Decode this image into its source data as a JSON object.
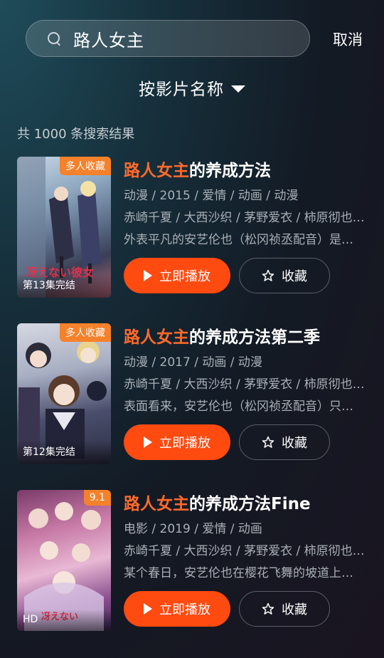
{
  "search": {
    "query": "路人女主",
    "cancel_label": "取消"
  },
  "sort": {
    "label": "按影片名称"
  },
  "result_count_text": "共 1000 条搜索结果",
  "results": [
    {
      "badge": "多人收藏",
      "episode_info": "第13集完结",
      "title_highlight": "路人女主",
      "title_rest": "的养成方法",
      "tags": "动漫 / 2015 / 爱情 / 动画 / 动漫",
      "cast": "赤崎千夏 / 大西沙织 / 茅野爱衣 / 柿原彻也…",
      "summary": "外表平凡的安艺伦也（松冈祯丞配音）是…",
      "play_label": "立即播放",
      "fav_label": "收藏"
    },
    {
      "badge": "多人收藏",
      "episode_info": "第12集完结",
      "title_highlight": "路人女主",
      "title_rest": "的养成方法第二季",
      "tags": "动漫 / 2017 / 动画 / 动漫",
      "cast": "赤崎千夏 / 大西沙织 / 茅野爱衣 / 柿原彻也…",
      "summary": "表面看来，安艺伦也（松冈祯丞配音）只…",
      "play_label": "立即播放",
      "fav_label": "收藏"
    },
    {
      "badge": "9.1",
      "episode_info": "HD",
      "title_highlight": "路人女主",
      "title_rest": "的养成方法Fine",
      "tags": "电影 / 2019 / 爱情 / 动画",
      "cast": "赤崎千夏 / 大西沙织 / 茅野爱衣 / 柿原彻也…",
      "summary": "某个春日，安艺伦也在樱花飞舞的坡道上…",
      "play_label": "立即播放",
      "fav_label": "收藏"
    }
  ]
}
